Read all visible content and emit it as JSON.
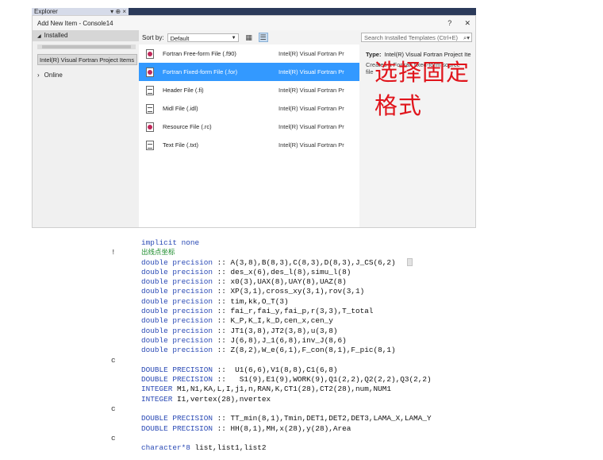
{
  "explorer": {
    "title": "Explorer",
    "controls": "▾ ⊕ ×"
  },
  "dialog": {
    "title": "Add New Item - Console14",
    "help": "?",
    "close": "✕",
    "tree": {
      "installed": "Installed",
      "fortran_items": "Intel(R) Visual Fortran Project Items",
      "online": "Online"
    },
    "sort_label": "Sort by:",
    "sort_value": "Default",
    "search_placeholder": "Search Installed Templates (Ctrl+E)",
    "items": [
      {
        "name": "Fortran Free-form File (.f90)",
        "category": "Intel(R) Visual Fortran Pr",
        "icon": "fortran-file-icon"
      },
      {
        "name": "Fortran Fixed-form File (.for)",
        "category": "Intel(R) Visual Fortran Pr",
        "icon": "fortran-file-icon",
        "selected": true
      },
      {
        "name": "Header File (.fi)",
        "category": "Intel(R) Visual Fortran Pr",
        "icon": "header-file-icon"
      },
      {
        "name": "Midl File (.idl)",
        "category": "Intel(R) Visual Fortran Pr",
        "icon": "midl-file-icon"
      },
      {
        "name": "Resource File (.rc)",
        "category": "Intel(R) Visual Fortran Pr",
        "icon": "resource-file-icon"
      },
      {
        "name": "Text File (.txt)",
        "category": "Intel(R) Visual Fortran Pr",
        "icon": "text-file-icon"
      }
    ],
    "details": {
      "type_label": "Type:",
      "type_value": "Intel(R) Visual Fortran Project Ite",
      "description": "Creates a Fortran fixed-form source file"
    }
  },
  "annotation": "选择固定格式",
  "code": [
    {
      "gutter": "",
      "text": "implicit none",
      "style": "kw"
    },
    {
      "gutter": "!",
      "text": "出线点坐标",
      "style": "cmt"
    },
    {
      "gutter": "",
      "text": "double precision :: A(3,8),B(8,3),C(8,3),D(8,3),J_CS(6,2)",
      "style": "decl"
    },
    {
      "gutter": "",
      "text": "double precision :: des_x(6),des_l(8),simu_l(8)",
      "style": "decl"
    },
    {
      "gutter": "",
      "text": "double precision :: x0(3),UAX(8),UAY(8),UAZ(8)",
      "style": "decl"
    },
    {
      "gutter": "",
      "text": "double precision :: XP(3,1),cross_xy(3,1),rov(3,1)",
      "style": "decl"
    },
    {
      "gutter": "",
      "text": "double precision :: tim,kk,O_T(3)",
      "style": "decl"
    },
    {
      "gutter": "",
      "text": "double precision :: fai_r,fai_y,fai_p,r(3,3),T_total",
      "style": "decl"
    },
    {
      "gutter": "",
      "text": "double precision :: K_P,K_I,k_D,cen_x,cen_y",
      "style": "decl"
    },
    {
      "gutter": "",
      "text": "double precision :: JT1(3,8),JT2(3,8),u(3,8)",
      "style": "decl"
    },
    {
      "gutter": "",
      "text": "double precision :: J(6,8),J_1(6,8),inv_J(8,6)",
      "style": "decl"
    },
    {
      "gutter": "",
      "text": "double precision :: Z(8,2),W_e(6,1),F_con(8,1),F_pic(8,1)",
      "style": "decl"
    },
    {
      "gutter": "c",
      "text": "",
      "style": "plain"
    },
    {
      "gutter": "",
      "text": "DOUBLE PRECISION ::  U1(6,6),V1(8,8),C1(6,8)",
      "style": "decl"
    },
    {
      "gutter": "",
      "text": "DOUBLE PRECISION ::   S1(9),E1(9),WORK(9),Q1(2,2),Q2(2,2),Q3(2,2)",
      "style": "decl"
    },
    {
      "gutter": "",
      "text": "INTEGER M1,N1,KA,L,I,j1,n,RAN,K,CT1(28),CT2(28),num,NUM1",
      "style": "decl"
    },
    {
      "gutter": "",
      "text": "INTEGER I1,vertex(28),nvertex",
      "style": "decl"
    },
    {
      "gutter": "c",
      "text": "",
      "style": "plain"
    },
    {
      "gutter": "",
      "text": "DOUBLE PRECISION :: TT_min(8,1),Tmin,DET1,DET2,DET3,LAMA_X,LAMA_Y",
      "style": "decl"
    },
    {
      "gutter": "",
      "text": "DOUBLE PRECISION :: HH(8,1),MH,x(28),y(28),Area",
      "style": "decl"
    },
    {
      "gutter": "c",
      "text": "",
      "style": "plain"
    },
    {
      "gutter": "",
      "text": "character*8 list,list1,list2",
      "style": "decl"
    }
  ]
}
